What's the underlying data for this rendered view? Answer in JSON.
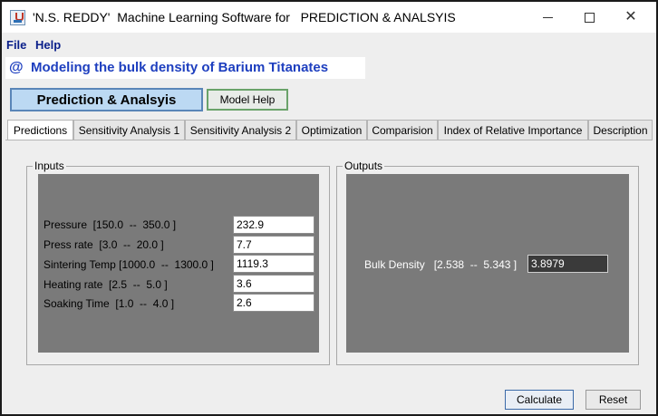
{
  "window": {
    "title": "'N.S. REDDY'  Machine Learning Software for   PREDICTION & ANALSYIS",
    "minimize_icon": "minimize-icon",
    "maximize_icon": "maximize-icon",
    "close_icon": "close-icon",
    "close_glyph": "✕"
  },
  "menu": {
    "file": "File",
    "help": "Help"
  },
  "header": {
    "icon_glyph": "@",
    "title": "Modeling the bulk density of Barium Titanates"
  },
  "toolbar": {
    "prediction_label": "Prediction & Analsyis",
    "model_help_label": "Model Help"
  },
  "tabs": [
    {
      "label": "Predictions",
      "active": true
    },
    {
      "label": "Sensitivity Analysis 1"
    },
    {
      "label": "Sensitivity Analysis 2"
    },
    {
      "label": "Optimization"
    },
    {
      "label": "Comparision"
    },
    {
      "label": "Index of Relative Importance"
    },
    {
      "label": "Description"
    }
  ],
  "inputs": {
    "group_label": "Inputs",
    "fields": [
      {
        "label": "Pressure  [150.0  --  350.0 ]",
        "value": "232.9"
      },
      {
        "label": "Press rate  [3.0  --  20.0 ]",
        "value": "7.7"
      },
      {
        "label": "Sintering Temp [1000.0  --  1300.0 ]",
        "value": "1119.3"
      },
      {
        "label": "Heating rate  [2.5  --  5.0 ]",
        "value": "3.6"
      },
      {
        "label": "Soaking Time  [1.0  --  4.0 ]",
        "value": "2.6"
      }
    ]
  },
  "outputs": {
    "group_label": "Outputs",
    "label": "Bulk Density   [2.538  --  5.343 ]",
    "value": "3.8979"
  },
  "actions": {
    "calculate_label": "Calculate",
    "reset_label": "Reset"
  },
  "colors": {
    "accent": "#1e3fbf",
    "panel": "#7a7a7a",
    "button_highlight": "#bcd9f3"
  }
}
